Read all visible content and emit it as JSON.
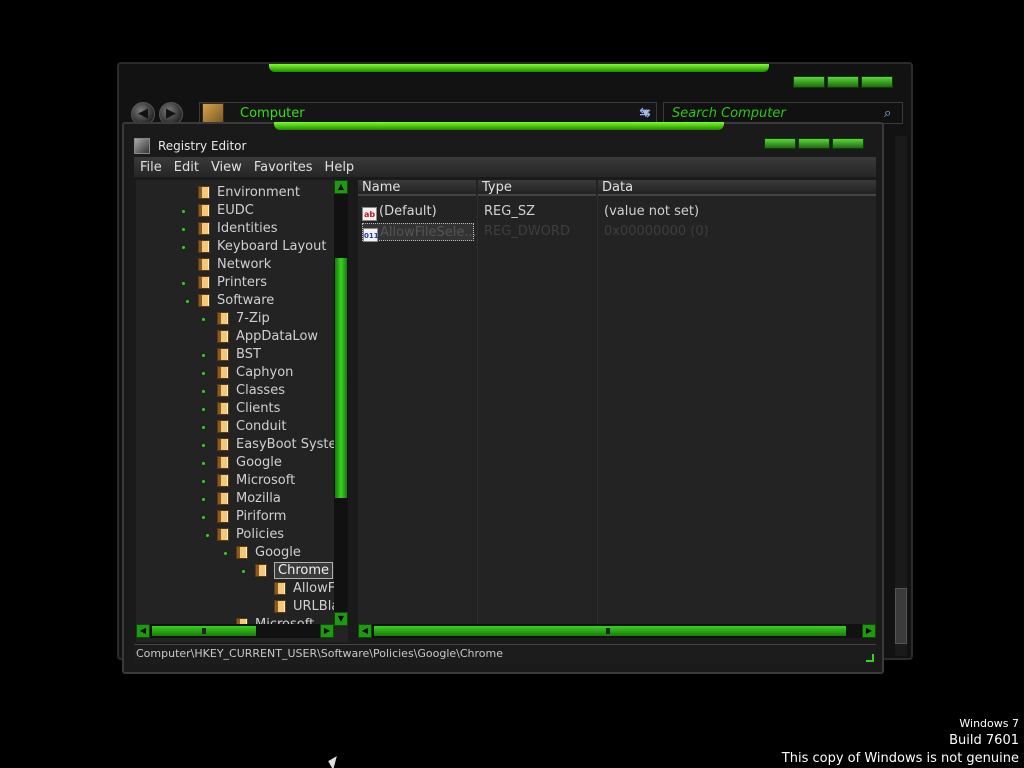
{
  "explorer": {
    "address": "Computer",
    "search_placeholder": "Search Computer",
    "back_glyph": "◀",
    "forward_glyph": "▶"
  },
  "regedit": {
    "title": "Registry Editor",
    "menu": [
      "File",
      "Edit",
      "View",
      "Favorites",
      "Help"
    ],
    "tree": [
      {
        "label": "Environment"
      },
      {
        "label": "EUDC"
      },
      {
        "label": "Identities"
      },
      {
        "label": "Keyboard Layout"
      },
      {
        "label": "Network"
      },
      {
        "label": "Printers"
      },
      {
        "label": "Software"
      },
      {
        "label": "7-Zip"
      },
      {
        "label": "AppDataLow"
      },
      {
        "label": "BST"
      },
      {
        "label": "Caphyon"
      },
      {
        "label": "Classes"
      },
      {
        "label": "Clients"
      },
      {
        "label": "Conduit"
      },
      {
        "label": "EasyBoot Syster"
      },
      {
        "label": "Google"
      },
      {
        "label": "Microsoft"
      },
      {
        "label": "Mozilla"
      },
      {
        "label": "Piriform"
      },
      {
        "label": "Policies"
      },
      {
        "label": "Google"
      },
      {
        "label": "Chrome"
      },
      {
        "label": "AllowF"
      },
      {
        "label": "URLBla"
      },
      {
        "label": "Microsoft"
      }
    ],
    "columns": [
      "Name",
      "Type",
      "Data"
    ],
    "values": [
      {
        "name": "(Default)",
        "type": "REG_SZ",
        "data": "(value not set)",
        "icon": "string-value-icon",
        "icon_text": "ab"
      },
      {
        "name": "AllowFileSele...",
        "type": "REG_DWORD",
        "data": "0x00000000 (0)",
        "icon": "binary-value-icon",
        "icon_text": "011"
      }
    ],
    "status_path": "Computer\\HKEY_CURRENT_USER\\Software\\Policies\\Google\\Chrome"
  },
  "watermark": {
    "line1": "Windows 7",
    "line2": "Build 7601",
    "line3": "This copy of Windows is not genuine"
  },
  "colors": {
    "accent_green": "#2dd61a",
    "window_bg": "#1a1a1a",
    "desktop_bg": "#000000"
  }
}
